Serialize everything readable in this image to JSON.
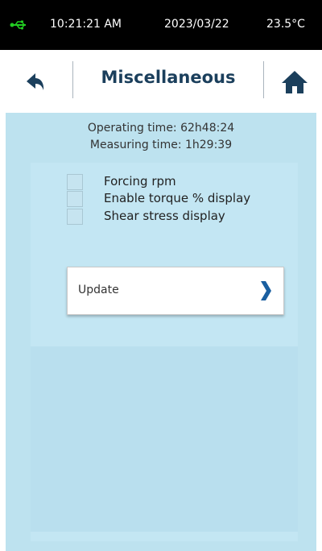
{
  "status_bar": {
    "time": "10:21:21 AM",
    "date": "2023/03/22",
    "temperature": "23.5°C",
    "usb_icon": "usb-icon",
    "usb_color": "#22cc22"
  },
  "header": {
    "title": "Miscellaneous",
    "back_icon": "back-arrow-icon",
    "home_icon": "home-icon",
    "accent": "#1b3f5c"
  },
  "info": {
    "operating_time": "Operating time: 62h48:24",
    "measuring_time": "Measuring time: 1h29:39"
  },
  "options": [
    {
      "label": "Forcing rpm",
      "checked": false
    },
    {
      "label": "Enable torque % display",
      "checked": false
    },
    {
      "label": "Shear stress display",
      "checked": false
    }
  ],
  "update_button": {
    "label": "Update",
    "icon": "chevron-right-icon",
    "icon_color": "#1a5fa0"
  }
}
